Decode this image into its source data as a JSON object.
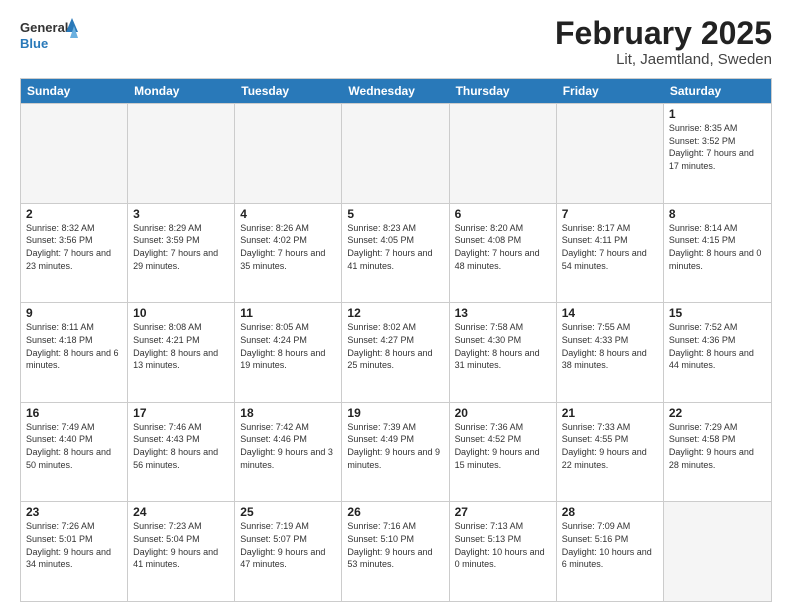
{
  "logo": {
    "text1": "General",
    "text2": "Blue"
  },
  "title": "February 2025",
  "subtitle": "Lit, Jaemtland, Sweden",
  "day_headers": [
    "Sunday",
    "Monday",
    "Tuesday",
    "Wednesday",
    "Thursday",
    "Friday",
    "Saturday"
  ],
  "weeks": [
    [
      {
        "num": "",
        "info": ""
      },
      {
        "num": "",
        "info": ""
      },
      {
        "num": "",
        "info": ""
      },
      {
        "num": "",
        "info": ""
      },
      {
        "num": "",
        "info": ""
      },
      {
        "num": "",
        "info": ""
      },
      {
        "num": "1",
        "info": "Sunrise: 8:35 AM\nSunset: 3:52 PM\nDaylight: 7 hours\nand 17 minutes."
      }
    ],
    [
      {
        "num": "2",
        "info": "Sunrise: 8:32 AM\nSunset: 3:56 PM\nDaylight: 7 hours\nand 23 minutes."
      },
      {
        "num": "3",
        "info": "Sunrise: 8:29 AM\nSunset: 3:59 PM\nDaylight: 7 hours\nand 29 minutes."
      },
      {
        "num": "4",
        "info": "Sunrise: 8:26 AM\nSunset: 4:02 PM\nDaylight: 7 hours\nand 35 minutes."
      },
      {
        "num": "5",
        "info": "Sunrise: 8:23 AM\nSunset: 4:05 PM\nDaylight: 7 hours\nand 41 minutes."
      },
      {
        "num": "6",
        "info": "Sunrise: 8:20 AM\nSunset: 4:08 PM\nDaylight: 7 hours\nand 48 minutes."
      },
      {
        "num": "7",
        "info": "Sunrise: 8:17 AM\nSunset: 4:11 PM\nDaylight: 7 hours\nand 54 minutes."
      },
      {
        "num": "8",
        "info": "Sunrise: 8:14 AM\nSunset: 4:15 PM\nDaylight: 8 hours\nand 0 minutes."
      }
    ],
    [
      {
        "num": "9",
        "info": "Sunrise: 8:11 AM\nSunset: 4:18 PM\nDaylight: 8 hours\nand 6 minutes."
      },
      {
        "num": "10",
        "info": "Sunrise: 8:08 AM\nSunset: 4:21 PM\nDaylight: 8 hours\nand 13 minutes."
      },
      {
        "num": "11",
        "info": "Sunrise: 8:05 AM\nSunset: 4:24 PM\nDaylight: 8 hours\nand 19 minutes."
      },
      {
        "num": "12",
        "info": "Sunrise: 8:02 AM\nSunset: 4:27 PM\nDaylight: 8 hours\nand 25 minutes."
      },
      {
        "num": "13",
        "info": "Sunrise: 7:58 AM\nSunset: 4:30 PM\nDaylight: 8 hours\nand 31 minutes."
      },
      {
        "num": "14",
        "info": "Sunrise: 7:55 AM\nSunset: 4:33 PM\nDaylight: 8 hours\nand 38 minutes."
      },
      {
        "num": "15",
        "info": "Sunrise: 7:52 AM\nSunset: 4:36 PM\nDaylight: 8 hours\nand 44 minutes."
      }
    ],
    [
      {
        "num": "16",
        "info": "Sunrise: 7:49 AM\nSunset: 4:40 PM\nDaylight: 8 hours\nand 50 minutes."
      },
      {
        "num": "17",
        "info": "Sunrise: 7:46 AM\nSunset: 4:43 PM\nDaylight: 8 hours\nand 56 minutes."
      },
      {
        "num": "18",
        "info": "Sunrise: 7:42 AM\nSunset: 4:46 PM\nDaylight: 9 hours\nand 3 minutes."
      },
      {
        "num": "19",
        "info": "Sunrise: 7:39 AM\nSunset: 4:49 PM\nDaylight: 9 hours\nand 9 minutes."
      },
      {
        "num": "20",
        "info": "Sunrise: 7:36 AM\nSunset: 4:52 PM\nDaylight: 9 hours\nand 15 minutes."
      },
      {
        "num": "21",
        "info": "Sunrise: 7:33 AM\nSunset: 4:55 PM\nDaylight: 9 hours\nand 22 minutes."
      },
      {
        "num": "22",
        "info": "Sunrise: 7:29 AM\nSunset: 4:58 PM\nDaylight: 9 hours\nand 28 minutes."
      }
    ],
    [
      {
        "num": "23",
        "info": "Sunrise: 7:26 AM\nSunset: 5:01 PM\nDaylight: 9 hours\nand 34 minutes."
      },
      {
        "num": "24",
        "info": "Sunrise: 7:23 AM\nSunset: 5:04 PM\nDaylight: 9 hours\nand 41 minutes."
      },
      {
        "num": "25",
        "info": "Sunrise: 7:19 AM\nSunset: 5:07 PM\nDaylight: 9 hours\nand 47 minutes."
      },
      {
        "num": "26",
        "info": "Sunrise: 7:16 AM\nSunset: 5:10 PM\nDaylight: 9 hours\nand 53 minutes."
      },
      {
        "num": "27",
        "info": "Sunrise: 7:13 AM\nSunset: 5:13 PM\nDaylight: 10 hours\nand 0 minutes."
      },
      {
        "num": "28",
        "info": "Sunrise: 7:09 AM\nSunset: 5:16 PM\nDaylight: 10 hours\nand 6 minutes."
      },
      {
        "num": "",
        "info": ""
      }
    ]
  ]
}
